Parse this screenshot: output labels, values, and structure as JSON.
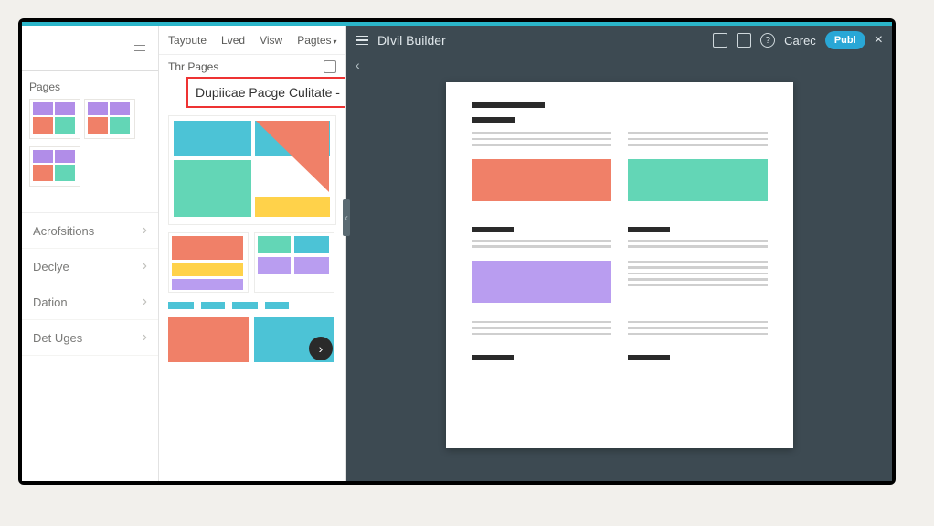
{
  "topbar": {
    "menu": {
      "layouts": "Tayoute",
      "lved": "Lved",
      "view": "Visw",
      "pages": "Pagtes"
    },
    "section_title": "Thr Pages"
  },
  "sidebar": {
    "pages_label": "Pages",
    "items": [
      {
        "label": "Acrofsitions"
      },
      {
        "label": "Declye"
      },
      {
        "label": "Dation"
      },
      {
        "label": "Det Uges"
      }
    ]
  },
  "popup": {
    "text": "Dupiicae Pacge Culitate - Duplicate Page"
  },
  "builder": {
    "title": "DIvil Builder",
    "user": "Carec",
    "action_btn": "Publ"
  }
}
